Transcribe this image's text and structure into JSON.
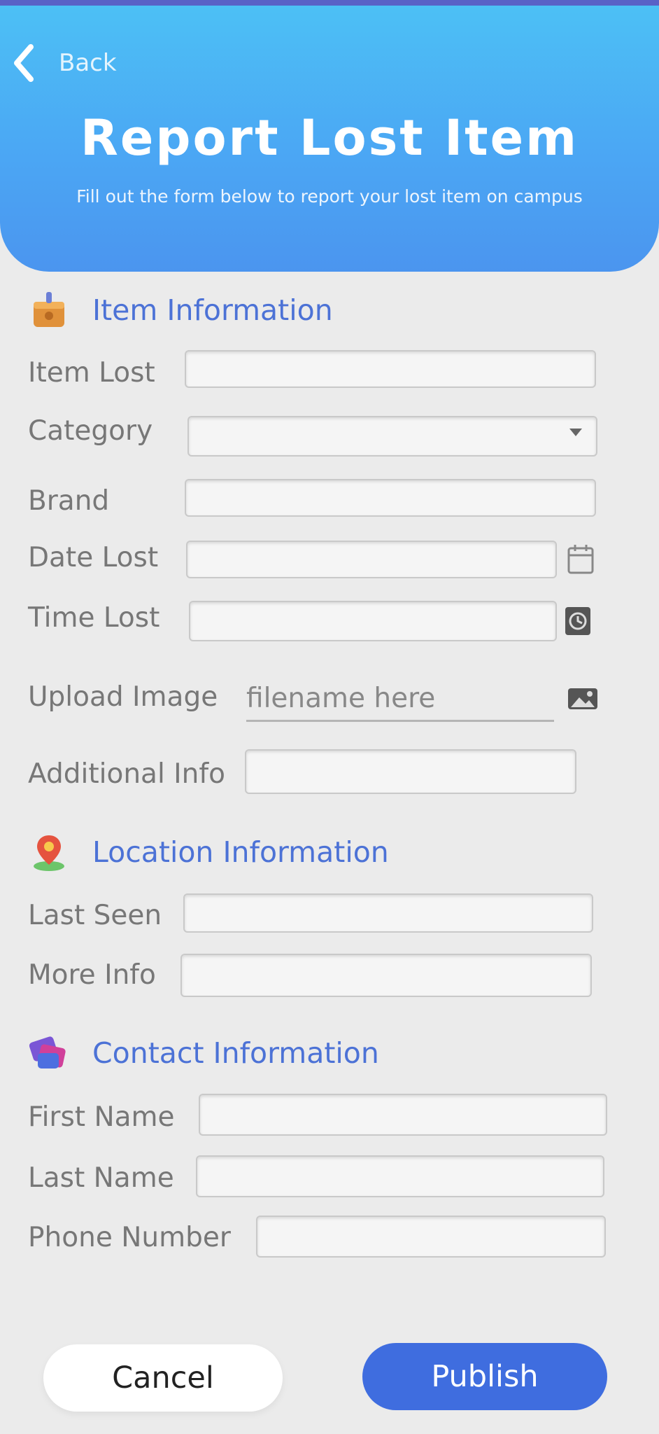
{
  "header": {
    "back_label": "Back",
    "title": "Report Lost Item",
    "subtitle": "Fill out the form below to report your lost item on campus"
  },
  "sections": {
    "item": {
      "title": "Item Information",
      "labels": {
        "item_lost": "Item Lost",
        "category": "Category",
        "brand": "Brand",
        "date_lost": "Date Lost",
        "time_lost": "Time Lost",
        "upload_image": "Upload Image",
        "additional_info": "Additional Info"
      },
      "upload_filename": "filename here"
    },
    "location": {
      "title": "Location Information",
      "labels": {
        "last_seen": "Last Seen",
        "more_info": "More Info"
      }
    },
    "contact": {
      "title": "Contact Information",
      "labels": {
        "first_name": "First Name",
        "last_name": "Last Name",
        "phone_number": "Phone Number"
      }
    }
  },
  "buttons": {
    "cancel": "Cancel",
    "publish": "Publish"
  },
  "colors": {
    "header_top": "#4cc0f5",
    "header_bottom": "#4b95ef",
    "accent": "#4c72d6",
    "publish": "#3f6ddf",
    "background": "#ebebeb"
  },
  "icons": {
    "back": "chevron-left-icon",
    "item_section": "box-icon",
    "location_section": "map-pin-icon",
    "contact_section": "contact-card-icon",
    "date": "calendar-icon",
    "time": "clock-icon",
    "upload": "image-icon"
  }
}
